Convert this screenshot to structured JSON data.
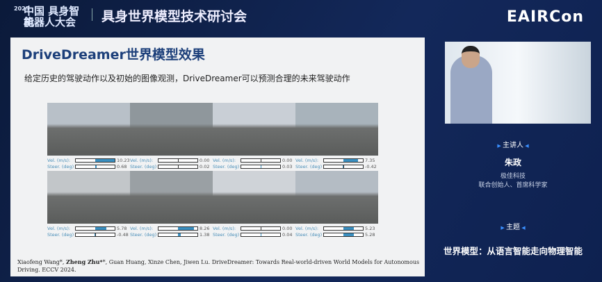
{
  "header": {
    "logo_year": "2025",
    "logo_line1": "中国 具身智能",
    "logo_line2": "机器人大会",
    "conference": "具身世界模型技术研讨会",
    "brand": "EAIRCon"
  },
  "slide": {
    "title": "DriveDreamer世界模型效果",
    "subtitle": "给定历史的驾驶动作以及初始的图像观测，DriveDreamer可以预测合理的未来驾驶动作",
    "vel_label": "Vel. (m/s):",
    "steer_label": "Steer. (deg)",
    "frames": [
      {
        "vel": "10.23",
        "steer": "0.68"
      },
      {
        "vel": "0.00",
        "steer": "0.02"
      },
      {
        "vel": "0.00",
        "steer": "0.03"
      },
      {
        "vel": "7.35",
        "steer": "-0.42"
      },
      {
        "vel": "5.78",
        "steer": "-0.48"
      },
      {
        "vel": "8.26",
        "steer": "1.38"
      },
      {
        "vel": "0.00",
        "steer": "0.04"
      },
      {
        "vel": "5.23",
        "steer": "5.28"
      }
    ],
    "citation_authors_a": "Xiaofeng Wang*, ",
    "citation_bold": "Zheng Zhu*",
    "citation_rest": "*, Guan Huang, Xinze Chen, Jiwen Lu. DriveDreamer: Towards Real-world-driven World Models for Autonomous Driving. ECCV 2024."
  },
  "panel": {
    "speaker_heading": "主讲人",
    "speaker_name": "朱政",
    "org": "极佳科技",
    "role": "联合创始人、首席科学家",
    "topic_heading": "主题",
    "topic": "世界模型：从语言智能走向物理智能"
  },
  "colors": {
    "bar_fill": "#3a8fc0",
    "title": "#1c3f7a",
    "background": "#0b1a3a"
  }
}
